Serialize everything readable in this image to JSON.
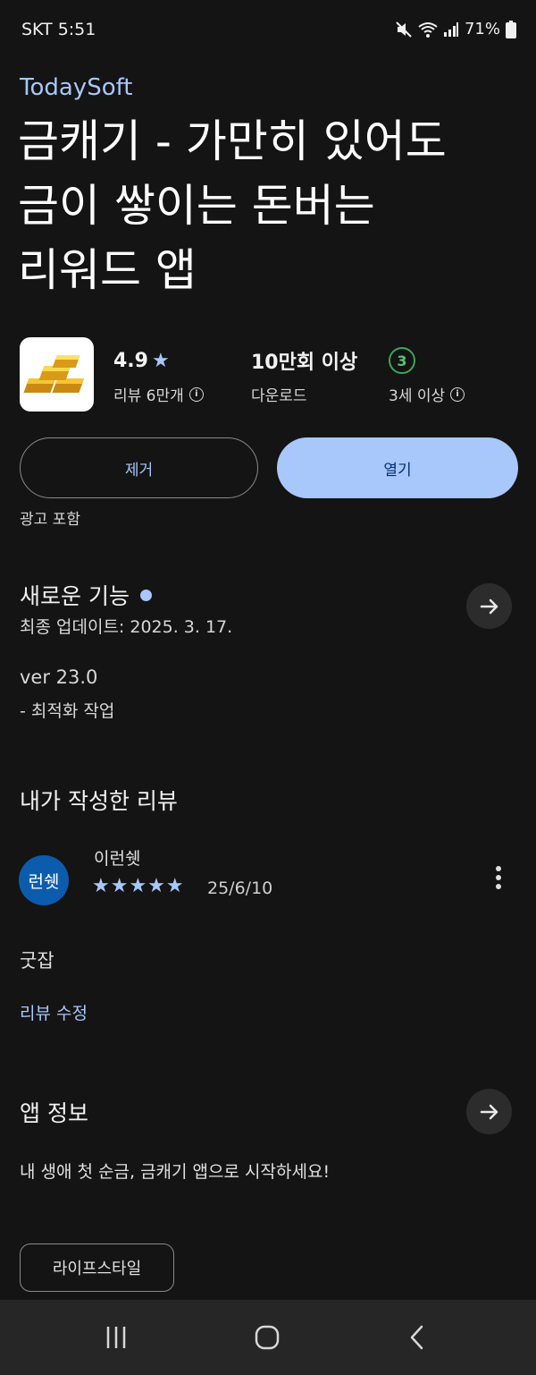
{
  "status_bar": {
    "carrier_time": "SKT 5:51",
    "battery": "71%",
    "icons": [
      "mute-icon",
      "wifi-icon",
      "signal-icon",
      "battery-icon"
    ]
  },
  "app": {
    "developer": "TodaySoft",
    "title_lines": [
      "금캐기 - 가만히 있어도",
      "금이 쌓이는 돈버는",
      "리워드 앱"
    ],
    "icon": "gold-bars-icon"
  },
  "stats": {
    "rating": "4.9",
    "rating_star": "★",
    "reviews": "리뷰 6만개",
    "downloads": "10만회 이상",
    "downloads_label": "다운로드",
    "age_rating_value": "3",
    "age_rating_label": "3세 이상"
  },
  "buttons": {
    "remove": "제거",
    "open": "열기"
  },
  "ads_label": "광고 포함",
  "whats_new": {
    "title": "새로운 기능",
    "updated": "최종 업데이트: 2025. 3. 17.",
    "version": "ver 23.0",
    "note": "- 최적화 작업"
  },
  "my_review": {
    "section_title": "내가 작성한 리뷰",
    "avatar_text": "런쉣",
    "reviewer": "이런쉣",
    "stars": "★★★★★",
    "date": "25/6/10",
    "body": "굿잡",
    "edit_label": "리뷰 수정"
  },
  "app_info": {
    "title": "앱 정보",
    "description": "내 생애 첫 순금, 금캐기 앱으로 시작하세요!",
    "category": "라이프스타일"
  },
  "colors": {
    "background": "#141414",
    "accent": "#a8c7fa",
    "age_badge": "#3aa65a",
    "avatar": "#0b5cad"
  }
}
